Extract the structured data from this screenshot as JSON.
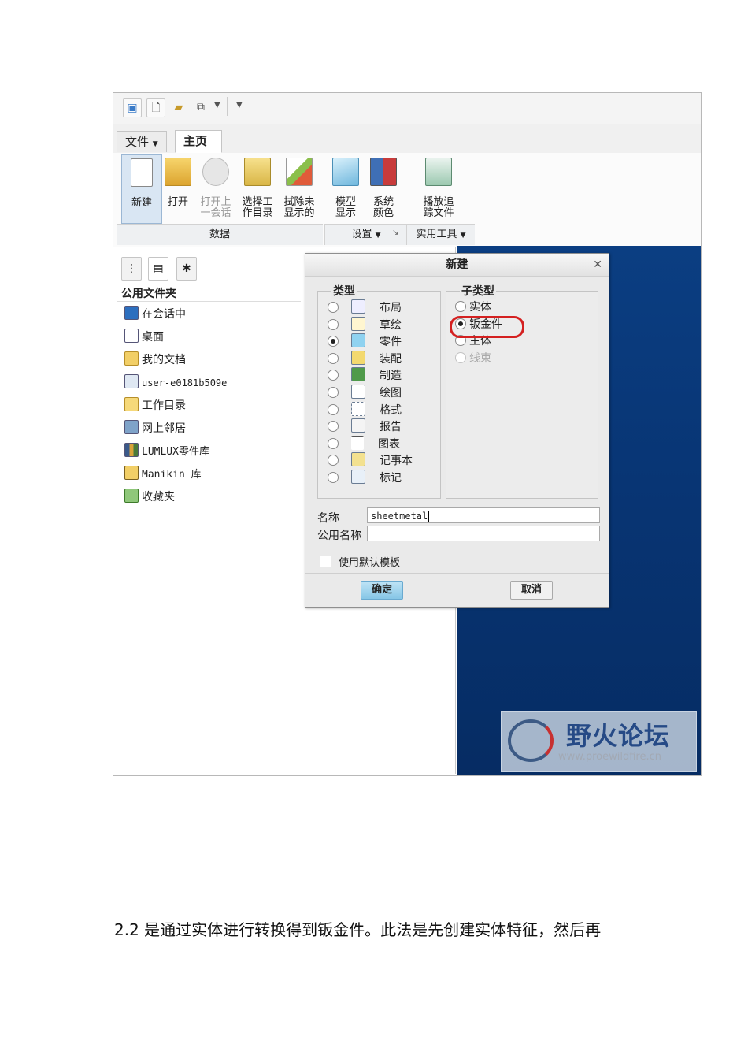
{
  "quick_access": {
    "icons": [
      "app-icon",
      "new-file-icon",
      "open-folder-icon",
      "window-icon",
      "dropdown-arrow-icon",
      "customize-arrow-icon"
    ]
  },
  "tabs": {
    "file": "文件",
    "home": "主页"
  },
  "ribbon": {
    "buttons": [
      {
        "id": "new",
        "label": "新建",
        "enabled": true,
        "icon": "blank-page-icon"
      },
      {
        "id": "open",
        "label": "打开",
        "enabled": true,
        "icon": "open-folder-icon"
      },
      {
        "id": "open_last_session",
        "label": "打开上\n一会话",
        "enabled": false,
        "icon": "session-icon"
      },
      {
        "id": "select_working_dir",
        "label": "选择工\n作目录",
        "enabled": true,
        "icon": "folder-check-icon"
      },
      {
        "id": "erase_not_displayed",
        "label": "拭除未\n显示的",
        "enabled": true,
        "icon": "eraser-icon"
      },
      {
        "id": "model_display",
        "label": "模型\n显示",
        "enabled": true,
        "icon": "cube-icon"
      },
      {
        "id": "system_colors",
        "label": "系统\n颜色",
        "enabled": true,
        "icon": "color-grid-icon"
      },
      {
        "id": "play_trail",
        "label": "播放追\n踪文件",
        "enabled": true,
        "icon": "trail-icon"
      }
    ],
    "groups": {
      "data": "数据",
      "settings": "设置",
      "utilities": "实用工具"
    }
  },
  "navigator": {
    "folder_title": "公用文件夹",
    "items": [
      "在会话中",
      "桌面",
      "我的文档",
      "user-e0181b509e",
      "工作目录",
      "网上邻居",
      "LUMLUX零件库",
      "Manikin 库",
      "收藏夹"
    ]
  },
  "dialog": {
    "title": "新建",
    "type_legend": "类型",
    "types": [
      "布局",
      "草绘",
      "零件",
      "装配",
      "制造",
      "绘图",
      "格式",
      "报告",
      "图表",
      "记事本",
      "标记"
    ],
    "selected_type": "零件",
    "subtype_legend": "子类型",
    "subtypes": [
      {
        "label": "实体",
        "enabled": true
      },
      {
        "label": "钣金件",
        "enabled": true
      },
      {
        "label": "主体",
        "enabled": true
      },
      {
        "label": "线束",
        "enabled": false
      }
    ],
    "selected_subtype": "钣金件",
    "highlight_color": "#d42020",
    "name_label": "名称",
    "name_value": "sheetmetal",
    "common_name_label": "公用名称",
    "common_name_value": "",
    "use_default_template_label": "使用默认模板",
    "use_default_template": false,
    "ok_label": "确定",
    "cancel_label": "取消"
  },
  "watermark": {
    "title": "野火论坛",
    "url": "www.proewildfire.cn"
  },
  "caption": {
    "number": "2.2",
    "text": "是通过实体进行转换得到钣金件。此法是先创建实体特征，然后再"
  }
}
